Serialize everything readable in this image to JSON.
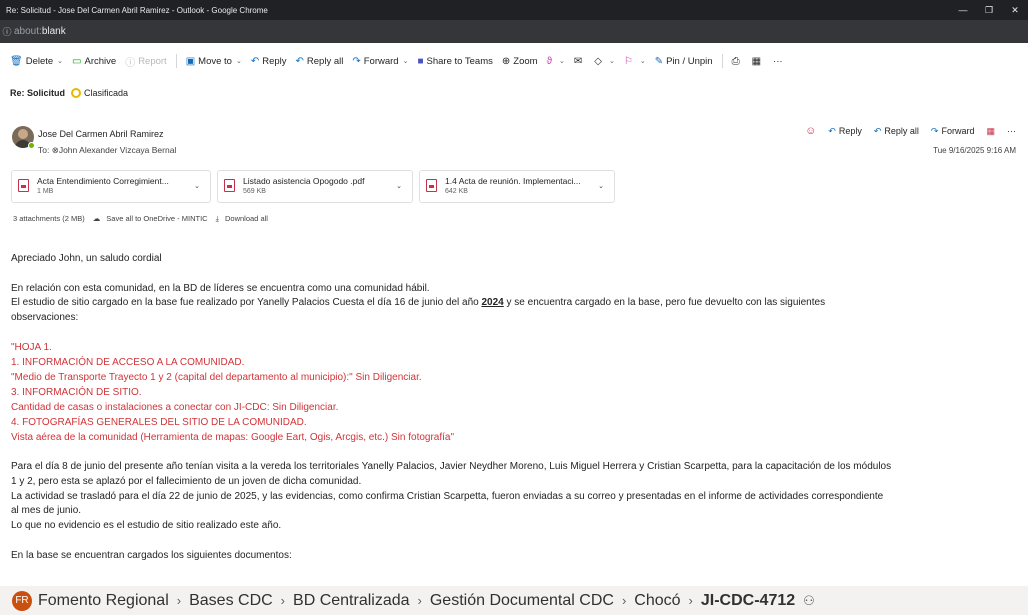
{
  "window": {
    "title": "Re: Solicitud - Jose Del Carmen Abril Ramirez - Outlook - Google Chrome",
    "minimize": "—",
    "restore": "❐",
    "close": "✕"
  },
  "addressbar": {
    "url_prefix": "about:",
    "url_host": "blank"
  },
  "toolbar": {
    "delete": "Delete",
    "archive": "Archive",
    "report": "Report",
    "move_to": "Move to",
    "reply": "Reply",
    "reply_all": "Reply all",
    "forward": "Forward",
    "share_to_teams": "Share to Teams",
    "zoom": "Zoom",
    "pin_unpin": "Pin / Unpin",
    "more": "···"
  },
  "message": {
    "subject": "Re: Solicitud",
    "tag": "Clasificada",
    "sender": "Jose Del Carmen Abril Ramirez",
    "to": "To:  ⊗John Alexander Vizcaya Bernal",
    "date": "Tue 9/16/2025 9:16 AM",
    "actions": {
      "reply": "Reply",
      "reply_all": "Reply all",
      "forward": "Forward",
      "more": "···"
    }
  },
  "attachments": [
    {
      "name": "Acta Entendimiento Corregimient...",
      "size": "1 MB"
    },
    {
      "name": "Listado asistencia Opogodo .pdf",
      "size": "569 KB"
    },
    {
      "name": "1.4 Acta de reunión. Implementaci...",
      "size": "642 KB"
    }
  ],
  "attachments_summary": {
    "count": "3 attachments (2 MB)",
    "save": "Save all to OneDrive - MINTIC",
    "download": "Download all"
  },
  "body": {
    "greeting": "Apreciado John, un saludo cordial",
    "p1_line1": "En relación con esta comunidad, en la BD de líderes se encuentra como una comunidad hábil.",
    "p1_line2_a": "El estudio de sitio cargado en la base fue realizado por Yanelly Palacios Cuesta el día 16 de junio del año ",
    "p1_line2_year": "2024",
    "p1_line2_b": " y se encuentra cargado en la base, pero fue devuelto con las siguientes",
    "p1_line3": "observaciones:",
    "obs": [
      "\"HOJA 1.",
      "1. INFORMACIÓN DE ACCESO A LA COMUNIDAD.",
      "\"Medio de Transporte Trayecto 1 y 2 (capital del departamento al municipio):\" Sin Diligenciar.",
      "3. INFORMACIÓN DE SITIO.",
      "Cantidad de casas o instalaciones a conectar con JI-CDC: Sin Diligenciar.",
      "4. FOTOGRAFÍAS GENERALES DEL SITIO DE LA COMUNIDAD.",
      "Vista aérea de la comunidad (Herramienta de mapas: Google Eart, Ogis, Arcgis, etc.) Sin fotografía\""
    ],
    "p2": [
      "Para el día 8 de junio del presente año tenían visita a la vereda los territoriales Yanelly Palacios, Javier Neydher Moreno, Luis Miguel Herrera y Cristian Scarpetta, para la capacitación de los módulos",
      "1 y 2, pero esta se aplazó por el fallecimiento de un joven de dicha comunidad.",
      "La actividad se trasladó para el día 22 de junio de 2025, y las evidencias, como confirma Cristian Scarpetta, fueron enviadas a su correo y presentadas en el informe de actividades correspondiente",
      "al mes de junio.",
      "Lo que no evidencio es el estudio de sitio realizado este año."
    ],
    "p3": "En la base se encuentran cargados los siguientes documentos:"
  },
  "breadcrumb": {
    "badge": "FR",
    "items": [
      "Fomento Regional",
      "Bases CDC",
      "BD Centralizada",
      "Gestión Documental CDC",
      "Chocó",
      "JI-CDC-4712"
    ],
    "separator": "›"
  },
  "colors": {
    "accent": "#0f6cbd",
    "observation_red": "#d13438",
    "tag_yellow": "#e8b900",
    "badge_orange": "#ca5010"
  }
}
